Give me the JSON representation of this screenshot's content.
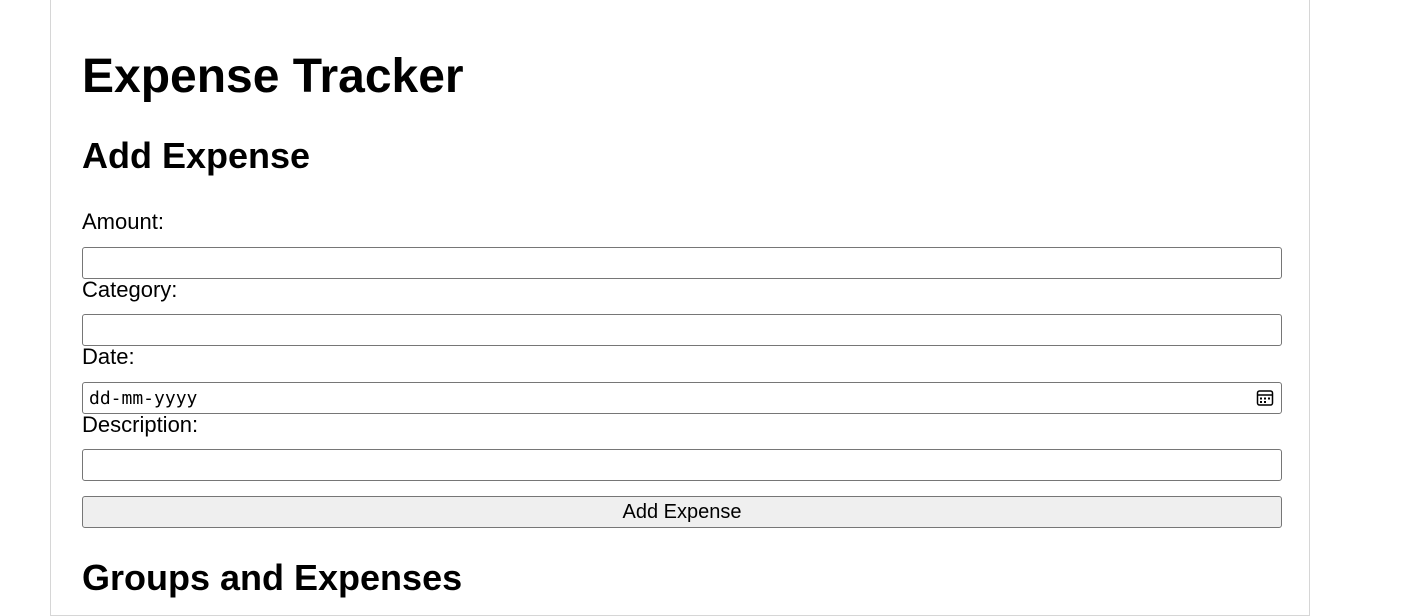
{
  "page": {
    "title": "Expense Tracker"
  },
  "add_expense": {
    "heading": "Add Expense",
    "amount_label": "Amount:",
    "amount_value": "",
    "category_label": "Category:",
    "category_value": "",
    "date_label": "Date:",
    "date_placeholder": "dd-mm-yyyy",
    "description_label": "Description:",
    "description_value": "",
    "submit_label": "Add Expense"
  },
  "groups": {
    "heading": "Groups and Expenses"
  },
  "icons": {
    "date_picker": "calendar-icon"
  },
  "colors": {
    "button_background": "#efefef",
    "input_border": "#767676",
    "container_border": "#d6d6d6"
  }
}
